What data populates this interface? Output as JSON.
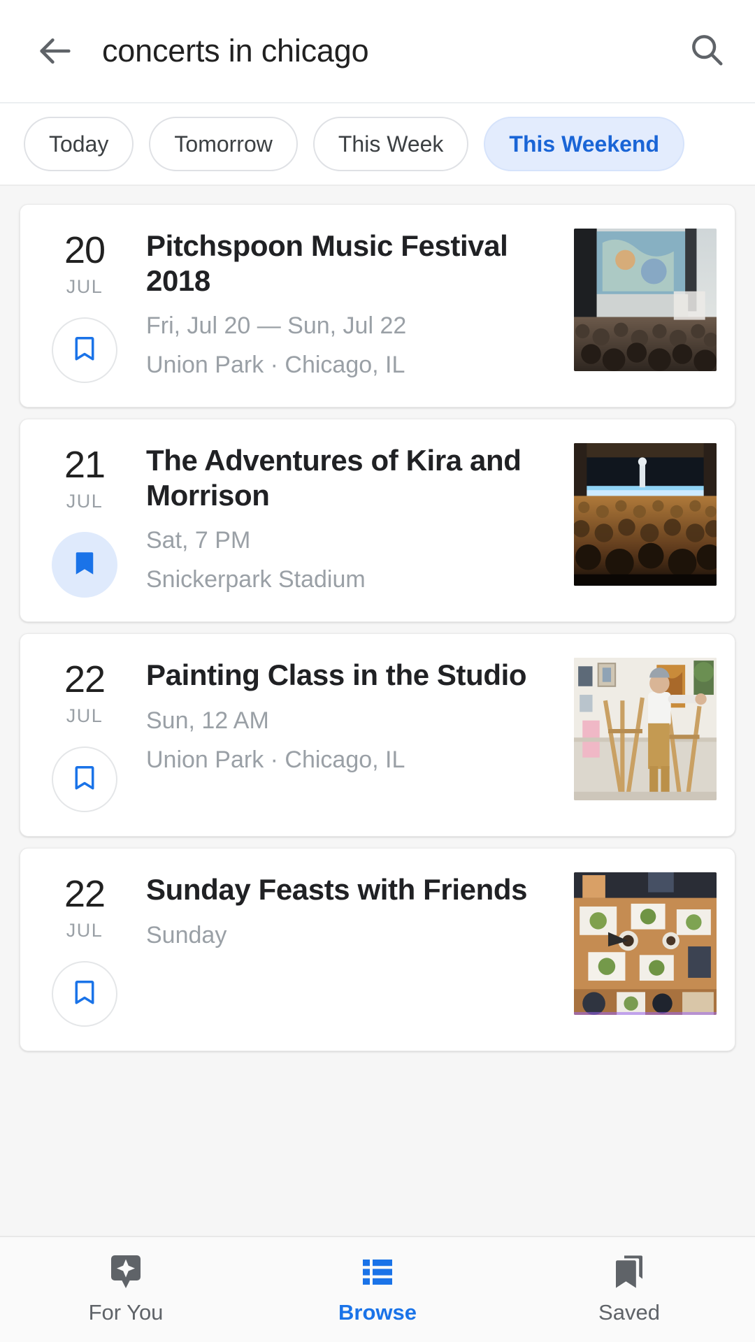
{
  "search": {
    "query": "concerts in chicago",
    "back_icon": "arrow-back-icon",
    "search_icon": "search-icon"
  },
  "filters": {
    "chips": [
      {
        "label": "Today",
        "active": false
      },
      {
        "label": "Tomorrow",
        "active": false
      },
      {
        "label": "This Week",
        "active": false
      },
      {
        "label": "This Weekend",
        "active": true
      }
    ]
  },
  "events": [
    {
      "day": "20",
      "month": "JUL",
      "title": "Pitchspoon Music Festival 2018",
      "when": "Fri, Jul 20 — Sun, Jul 22",
      "where": "Union Park · Chicago, IL",
      "saved": false,
      "bookmark_icon": "bookmark-outline-icon",
      "thumbnail": "outdoor-music-festival-crowd-photo"
    },
    {
      "day": "21",
      "month": "JUL",
      "title": "The Adventures of Kira and Morrison",
      "when": "Sat, 7 PM",
      "where": "Snickerpark Stadium",
      "saved": true,
      "bookmark_icon": "bookmark-filled-icon",
      "thumbnail": "indoor-concert-stage-audience-photo"
    },
    {
      "day": "22",
      "month": "JUL",
      "title": "Painting Class in the Studio",
      "when": "Sun, 12 AM",
      "where": "Union Park · Chicago, IL",
      "saved": false,
      "bookmark_icon": "bookmark-outline-icon",
      "thumbnail": "art-studio-painter-easel-photo"
    },
    {
      "day": "22",
      "month": "JUL",
      "title": "Sunday Feasts with Friends",
      "when": "Sunday",
      "where": "",
      "saved": false,
      "bookmark_icon": "bookmark-outline-icon",
      "thumbnail": "overhead-dinner-table-food-photo"
    }
  ],
  "bottom_nav": {
    "items": [
      {
        "label": "For You",
        "icon": "sparkle-pin-icon",
        "active": false
      },
      {
        "label": "Browse",
        "icon": "list-view-icon",
        "active": true
      },
      {
        "label": "Saved",
        "icon": "stacked-bookmark-icon",
        "active": false
      }
    ]
  },
  "colors": {
    "accent": "#1a73e8",
    "chip_active_bg": "#e3ecfd",
    "chip_active_text": "#1a65d6",
    "saved_bg": "#dfeafc",
    "text_primary": "#202124",
    "text_secondary": "#9aa0a6"
  }
}
